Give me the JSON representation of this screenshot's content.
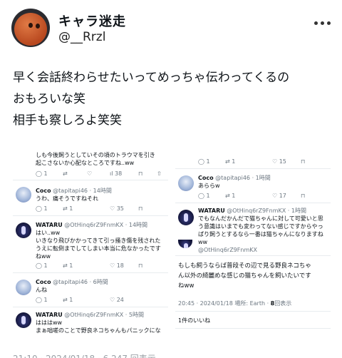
{
  "header": {
    "display_name": "キャラ迷走",
    "handle": "@__Rrzl"
  },
  "post": {
    "lines": [
      "早く会話終わらせたいってめっちゃ伝わってくるの",
      "おもろいな笑",
      "相手も察しろよ笑笑"
    ]
  },
  "left_shot": {
    "t1": {
      "text": [
        "しも今後飼うとしていその頃のトラウマを引き",
        "起こさないか心配なところですね..ww"
      ],
      "counts": {
        "replies": "1",
        "likes": "38"
      }
    },
    "t2": {
      "name": "Coco",
      "handle": "@tapitapi46",
      "time": "· 14時間",
      "text": "うわ、痛そうですねそれ",
      "counts": {
        "replies": "1",
        "retweets": "1",
        "likes": "35"
      }
    },
    "t3": {
      "name": "WATARU",
      "handle": "@OtHinq6rZ9FnmKX",
      "time": "· 14時間",
      "text": [
        "はい..ww",
        "いきなり飛びかかってきて引っ掻き傷を残された",
        "うえに転倒までしてしまい本当に危なかったです",
        "ねww"
      ],
      "counts": {
        "replies": "1",
        "retweets": "1",
        "likes": "18"
      }
    },
    "t4": {
      "name": "Coco",
      "handle": "@tapitapi46",
      "time": "· 6時間",
      "text": "んね",
      "counts": {
        "replies": "1",
        "retweets": "1",
        "likes": "24"
      }
    },
    "t5": {
      "name": "WATARU",
      "handle": "@OtHinq6rZ9FnmKX",
      "time": "· 5時間",
      "text": [
        "はははww",
        "まぁ咄嗟のことで野良ネコちゃんもパニックにな"
      ]
    }
  },
  "right_shot": {
    "top_counts": {
      "replies": "1",
      "retweets": "1",
      "likes": "15"
    },
    "t1": {
      "name": "Coco",
      "handle": "@tapitapi46",
      "time": "· 1時間",
      "text": "あららw",
      "counts": {
        "replies": "1",
        "retweets": "1",
        "likes": "17"
      }
    },
    "t2": {
      "name": "WATARU",
      "handle": "@OtHinq6rZ9FnmKX",
      "time": "· 1時間",
      "text": [
        "でもなんだかんだで猫ちゃんに対して可愛いと思",
        "う意識はいまでも変わってない感じですからやっ",
        "ぱり飼うとするなら一番は猫ちゃんになりますね",
        "ww"
      ]
    },
    "t3": {
      "handle": "@OtHinq6rZ9FnmKX"
    },
    "main": {
      "text": [
        "もしも飼うならば普段その辺で見る野良ネコちゃ",
        "ん以外の綺麗めな感じの猫ちゃんを飼いたいです",
        "ねww"
      ],
      "meta": "20:45 · 2024/01/18 場所: Earth · ",
      "views": "8",
      "views_label": "回表示",
      "likes": "1件のいいね"
    }
  },
  "footer": {
    "partial": "21:10 · 2024/01/18 · 6,247 回表示"
  }
}
